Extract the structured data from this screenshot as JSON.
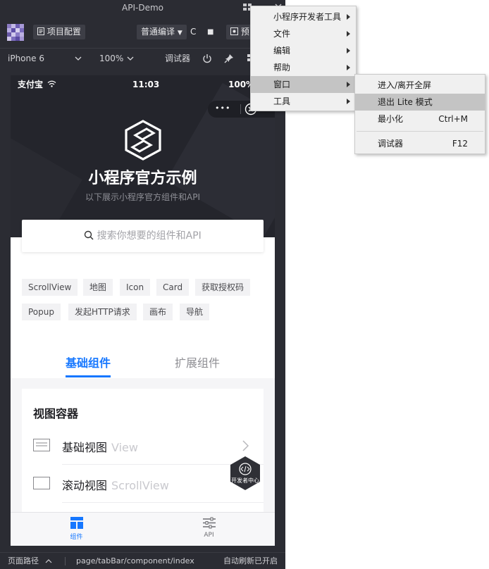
{
  "window": {
    "title": "API-Demo"
  },
  "toolbar": {
    "project_config": "项目配置",
    "compile_mode": "普通编译",
    "refresh": "C",
    "stop": "■",
    "preview": "预"
  },
  "device_bar": {
    "device": "iPhone 6",
    "zoom": "100%",
    "debugger": "调试器"
  },
  "status_bar": {
    "carrier": "支付宝",
    "time": "11:03",
    "battery": "100%"
  },
  "capsule": {
    "more": "•••"
  },
  "hero": {
    "title": "小程序官方示例",
    "subtitle": "以下展示小程序官方组件和API"
  },
  "search": {
    "placeholder": "搜索你想要的组件和API"
  },
  "tags": [
    "ScrollView",
    "地图",
    "Icon",
    "Card",
    "获取授权码",
    "Popup",
    "发起HTTP请求",
    "画布",
    "导航"
  ],
  "tabs": [
    {
      "label": "基础组件",
      "active": true
    },
    {
      "label": "扩展组件",
      "active": false
    }
  ],
  "section": {
    "title": "视图容器",
    "rows": [
      {
        "label": "基础视图",
        "en": "View"
      },
      {
        "label": "滚动视图",
        "en": "ScrollView"
      }
    ]
  },
  "tabbar": {
    "components": "组件",
    "api": "API"
  },
  "floater": {
    "label": "开发者中心"
  },
  "bottom_bar": {
    "path_label": "页面路径",
    "path": "page/tabBar/component/index",
    "auto_refresh": "自动刷新已开启"
  },
  "menu": {
    "items": [
      {
        "label": "小程序开发者工具",
        "has_submenu": true
      },
      {
        "label": "文件",
        "has_submenu": true
      },
      {
        "label": "编辑",
        "has_submenu": true
      },
      {
        "label": "帮助",
        "has_submenu": true
      },
      {
        "label": "窗口",
        "has_submenu": true,
        "highlighted": true
      },
      {
        "label": "工具",
        "has_submenu": true
      }
    ],
    "submenu": [
      {
        "label": "进入/离开全屏",
        "shortcut": ""
      },
      {
        "label": "退出 Lite 模式",
        "shortcut": "",
        "highlighted": true
      },
      {
        "label": "最小化",
        "shortcut": "Ctrl+M"
      },
      {
        "label": "调试器",
        "shortcut": "F12"
      }
    ]
  },
  "colors": {
    "accent": "#1677ff",
    "ide_bg": "#2b2c33",
    "hero_bg": "#24252c",
    "menu_highlight": "#c4c4c4"
  }
}
